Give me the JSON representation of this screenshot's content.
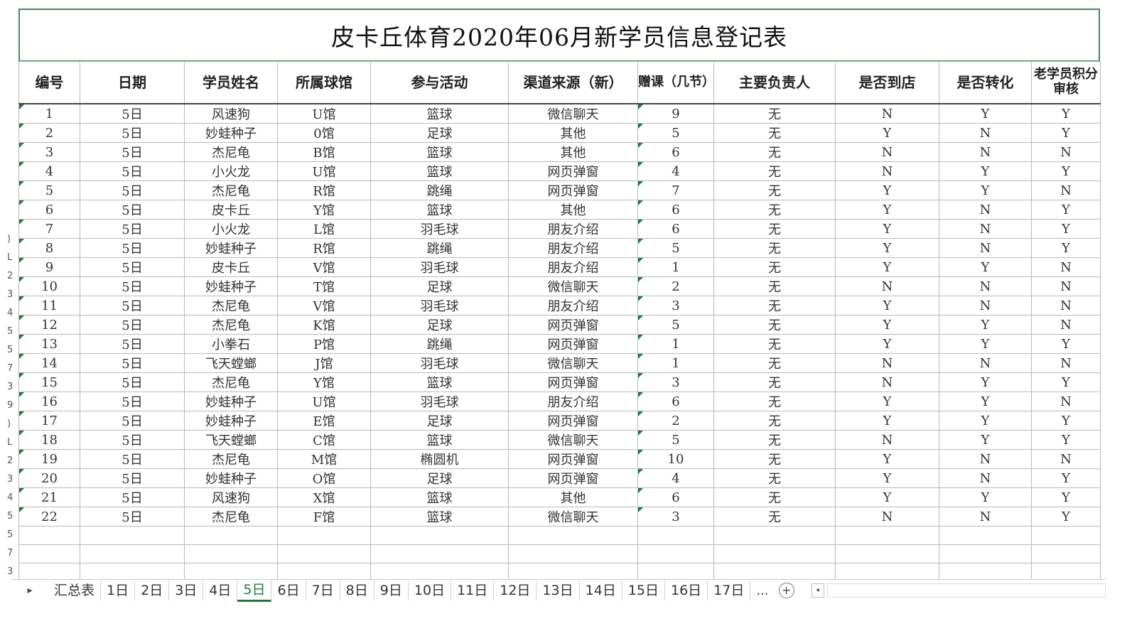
{
  "title": "皮卡丘体育2020年06月新学员信息登记表",
  "headers": [
    "编号",
    "日期",
    "学员姓名",
    "所属球馆",
    "参与活动",
    "渠道来源（新）",
    "赠课（几节）",
    "主要负责人",
    "是否到店",
    "是否转化",
    "老学员积分审核"
  ],
  "rows": [
    [
      "1",
      "5日",
      "风速狗",
      "U馆",
      "篮球",
      "微信聊天",
      "9",
      "无",
      "N",
      "Y",
      "Y"
    ],
    [
      "2",
      "5日",
      "妙蛙种子",
      "0馆",
      "足球",
      "其他",
      "5",
      "无",
      "Y",
      "N",
      "Y"
    ],
    [
      "3",
      "5日",
      "杰尼龟",
      "B馆",
      "篮球",
      "其他",
      "6",
      "无",
      "N",
      "N",
      "N"
    ],
    [
      "4",
      "5日",
      "小火龙",
      "U馆",
      "篮球",
      "网页弹窗",
      "4",
      "无",
      "N",
      "Y",
      "Y"
    ],
    [
      "5",
      "5日",
      "杰尼龟",
      "R馆",
      "跳绳",
      "网页弹窗",
      "7",
      "无",
      "Y",
      "Y",
      "N"
    ],
    [
      "6",
      "5日",
      "皮卡丘",
      "Y馆",
      "篮球",
      "其他",
      "6",
      "无",
      "Y",
      "N",
      "Y"
    ],
    [
      "7",
      "5日",
      "小火龙",
      "L馆",
      "羽毛球",
      "朋友介绍",
      "6",
      "无",
      "Y",
      "N",
      "Y"
    ],
    [
      "8",
      "5日",
      "妙蛙种子",
      "R馆",
      "跳绳",
      "朋友介绍",
      "5",
      "无",
      "Y",
      "N",
      "Y"
    ],
    [
      "9",
      "5日",
      "皮卡丘",
      "V馆",
      "羽毛球",
      "朋友介绍",
      "1",
      "无",
      "Y",
      "Y",
      "N"
    ],
    [
      "10",
      "5日",
      "妙蛙种子",
      "T馆",
      "足球",
      "微信聊天",
      "2",
      "无",
      "N",
      "N",
      "N"
    ],
    [
      "11",
      "5日",
      "杰尼龟",
      "V馆",
      "羽毛球",
      "朋友介绍",
      "3",
      "无",
      "Y",
      "N",
      "N"
    ],
    [
      "12",
      "5日",
      "杰尼龟",
      "K馆",
      "足球",
      "网页弹窗",
      "5",
      "无",
      "Y",
      "Y",
      "N"
    ],
    [
      "13",
      "5日",
      "小拳石",
      "P馆",
      "跳绳",
      "网页弹窗",
      "1",
      "无",
      "Y",
      "Y",
      "Y"
    ],
    [
      "14",
      "5日",
      "飞天螳螂",
      "J馆",
      "羽毛球",
      "微信聊天",
      "1",
      "无",
      "N",
      "N",
      "N"
    ],
    [
      "15",
      "5日",
      "杰尼龟",
      "Y馆",
      "篮球",
      "网页弹窗",
      "3",
      "无",
      "N",
      "Y",
      "Y"
    ],
    [
      "16",
      "5日",
      "妙蛙种子",
      "U馆",
      "羽毛球",
      "朋友介绍",
      "6",
      "无",
      "Y",
      "Y",
      "N"
    ],
    [
      "17",
      "5日",
      "妙蛙种子",
      "E馆",
      "足球",
      "网页弹窗",
      "2",
      "无",
      "Y",
      "Y",
      "Y"
    ],
    [
      "18",
      "5日",
      "飞天螳螂",
      "C馆",
      "篮球",
      "微信聊天",
      "5",
      "无",
      "N",
      "Y",
      "Y"
    ],
    [
      "19",
      "5日",
      "杰尼龟",
      "M馆",
      "椭圆机",
      "网页弹窗",
      "10",
      "无",
      "Y",
      "N",
      "N"
    ],
    [
      "20",
      "5日",
      "妙蛙种子",
      "O馆",
      "足球",
      "网页弹窗",
      "4",
      "无",
      "Y",
      "N",
      "Y"
    ],
    [
      "21",
      "5日",
      "风速狗",
      "X馆",
      "篮球",
      "其他",
      "6",
      "无",
      "Y",
      "Y",
      "Y"
    ],
    [
      "22",
      "5日",
      "杰尼龟",
      "F馆",
      "篮球",
      "微信聊天",
      "3",
      "无",
      "N",
      "N",
      "Y"
    ]
  ],
  "row_numbers_left": [
    ")",
    "L",
    "2",
    "3",
    "4",
    "5",
    "5",
    "7",
    "3",
    "9",
    ")",
    "L",
    "2",
    "3",
    "4",
    "5",
    "5",
    "7",
    "3"
  ],
  "tabs": [
    "汇总表",
    "1日",
    "2日",
    "3日",
    "4日",
    "5日",
    "6日",
    "7日",
    "8日",
    "9日",
    "10日",
    "11日",
    "12日",
    "13日",
    "14日",
    "15日",
    "16日",
    "17日"
  ],
  "active_tab": "5日",
  "more_tabs": "...",
  "add_sheet_symbol": "+",
  "accent_color": "#1e7b34"
}
